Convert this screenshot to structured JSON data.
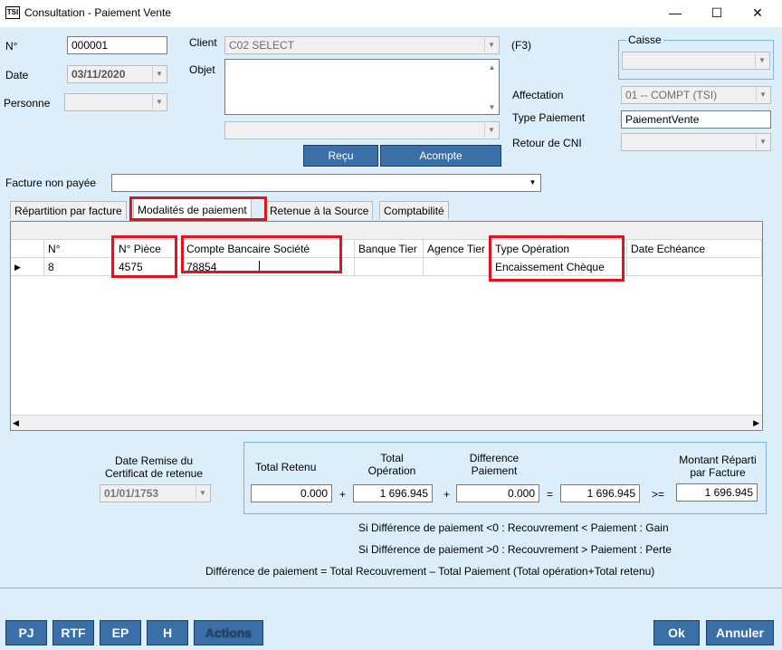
{
  "window": {
    "title": "Consultation - Paiement Vente",
    "icon_text": "TSI",
    "minimize_glyph": "—",
    "maximize_glyph": "☐",
    "close_glyph": "✕"
  },
  "form": {
    "no_label": "N°",
    "no_value": "000001",
    "date_label": "Date",
    "date_value": "03/11/2020",
    "personne_label": "Personne",
    "personne_value": "",
    "client_label": "Client",
    "client_value": "C02 SELECT",
    "f3_label": "(F3)",
    "objet_label": "Objet",
    "objet_value": "",
    "objet2_value": "",
    "recu_label": "Reçu",
    "acompte_label": "Acompte",
    "caisse_label": "Caisse",
    "caisse_value": "",
    "affectation_label": "Affectation",
    "affectation_value": "01 -- COMPT (TSI)",
    "type_paiement_label": "Type Paiement",
    "type_paiement_value": "PaiementVente",
    "retour_cni_label": "Retour de CNI",
    "retour_cni_value": "",
    "facture_label": "Facture non payée",
    "facture_value": ""
  },
  "tabs": [
    {
      "label": "Répartition par facture",
      "active": false
    },
    {
      "label": "Modalités de paiement",
      "active": true
    },
    {
      "label": "Retenue à la Source",
      "active": false
    },
    {
      "label": "Comptabilité",
      "active": false
    }
  ],
  "grid": {
    "columns": [
      "N°",
      "N° Pièce",
      "Compte Bancaire Société",
      "Banque Tier",
      "Agence Tier",
      "Type Opération",
      "Date Echéance"
    ],
    "rows": [
      {
        "no": "8",
        "piece": "4575",
        "compte": "78854",
        "banque": "",
        "agence": "",
        "type_operation": "Encaissement Chèque",
        "date_echeance": ""
      }
    ],
    "row_pointer": "▶",
    "scroll_left": "◀",
    "scroll_right": "▶"
  },
  "totals": {
    "date_remise_label": "Date Remise du Certificat de retenue",
    "date_remise_value": "01/01/1753",
    "total_retenu_label": "Total Retenu",
    "total_retenu_value": "0.000",
    "total_operation_label": "Total Opération",
    "total_operation_value": "1 696.945",
    "difference_label": "Difference Paiement",
    "difference_value": "0.000",
    "montant_label": "Montant Réparti par Facture",
    "montant_value": "1 696.945",
    "op_plus1": "+",
    "op_plus2": "+",
    "op_eq": "=",
    "op_ge": ">="
  },
  "notes": {
    "line1": "Si Différence de paiement <0 : Recouvrement < Paiement : Gain",
    "line2": "Si Différence de paiement >0 : Recouvrement > Paiement : Perte",
    "line3": "Différence de paiement = Total Recouvrement – Total Paiement (Total opération+Total retenu)"
  },
  "buttons": {
    "pj": "PJ",
    "rtf": "RTF",
    "ep": "EP",
    "h": "H",
    "actions": "Actions",
    "ok": "Ok",
    "annuler": "Annuler"
  },
  "colors": {
    "client_bg": "#dceefa",
    "button_blue": "#3b6fa8",
    "highlight_red": "#e0141e"
  }
}
